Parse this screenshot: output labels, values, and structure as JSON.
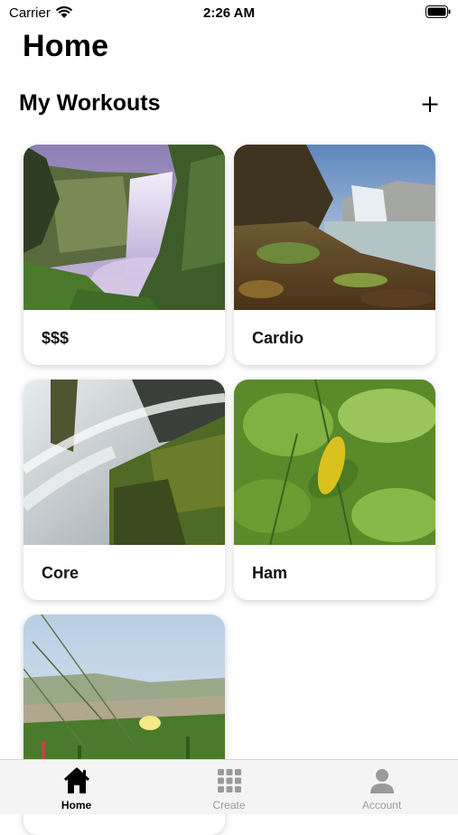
{
  "status_bar": {
    "carrier": "Carrier",
    "time": "2:26 AM"
  },
  "header": {
    "title": "Home"
  },
  "section": {
    "title": "My Workouts",
    "add_icon": "plus-icon"
  },
  "workouts": [
    {
      "label": "$$$",
      "image": "waterfall-cliff"
    },
    {
      "label": "Cardio",
      "image": "waterfall-lake"
    },
    {
      "label": "Core",
      "image": "waterfall-rocks"
    },
    {
      "label": "Ham",
      "image": "green-leaves"
    },
    {
      "label": "",
      "image": "flower-grass"
    }
  ],
  "tabbar": {
    "items": [
      {
        "label": "Home",
        "icon": "home-icon",
        "active": true
      },
      {
        "label": "Create",
        "icon": "grid-icon",
        "active": false
      },
      {
        "label": "Account",
        "icon": "person-icon",
        "active": false
      }
    ]
  },
  "colors": {
    "active": "#000000",
    "inactive": "#9a9a9a",
    "tabbar_bg": "#f4f4f4"
  }
}
